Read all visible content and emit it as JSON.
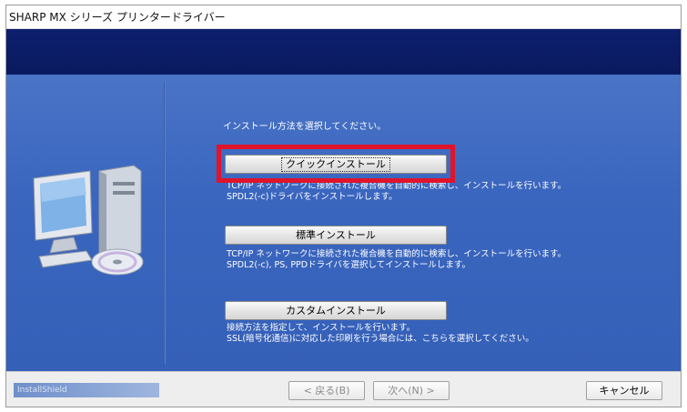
{
  "window": {
    "title": "SHARP MX シリーズ プリンタードライバー"
  },
  "main": {
    "instruction": "インストール方法を選択してください。",
    "options": [
      {
        "label": "クイックインストール",
        "description": [
          "TCP/IP ネットワークに接続された複合機を自動的に検索し、インストールを行います。",
          "SPDL2(-c)ドライバをインストールします。"
        ]
      },
      {
        "label": "標準インストール",
        "description": [
          "TCP/IP ネットワークに接続された複合機を自動的に検索し、インストールを行います。",
          "SPDL2(-c), PS, PPDドライバを選択してインストールします。"
        ]
      },
      {
        "label": "カスタムインストール",
        "description": [
          "接続方法を指定して、インストールを行います。",
          "SSL(暗号化通信)に対応した印刷を行う場合には、こちらを選択してください。"
        ]
      }
    ]
  },
  "footer": {
    "brand": "InstallShield",
    "back_label": "< 戻る(B)",
    "next_label": "次へ(N) >",
    "cancel_label": "キャンセル"
  },
  "colors": {
    "banner": "#0d1f6e",
    "content_bg": "#3a66bf",
    "highlight": "#e0142a"
  },
  "icons": {
    "illustration": "computer-with-disc-icon"
  }
}
